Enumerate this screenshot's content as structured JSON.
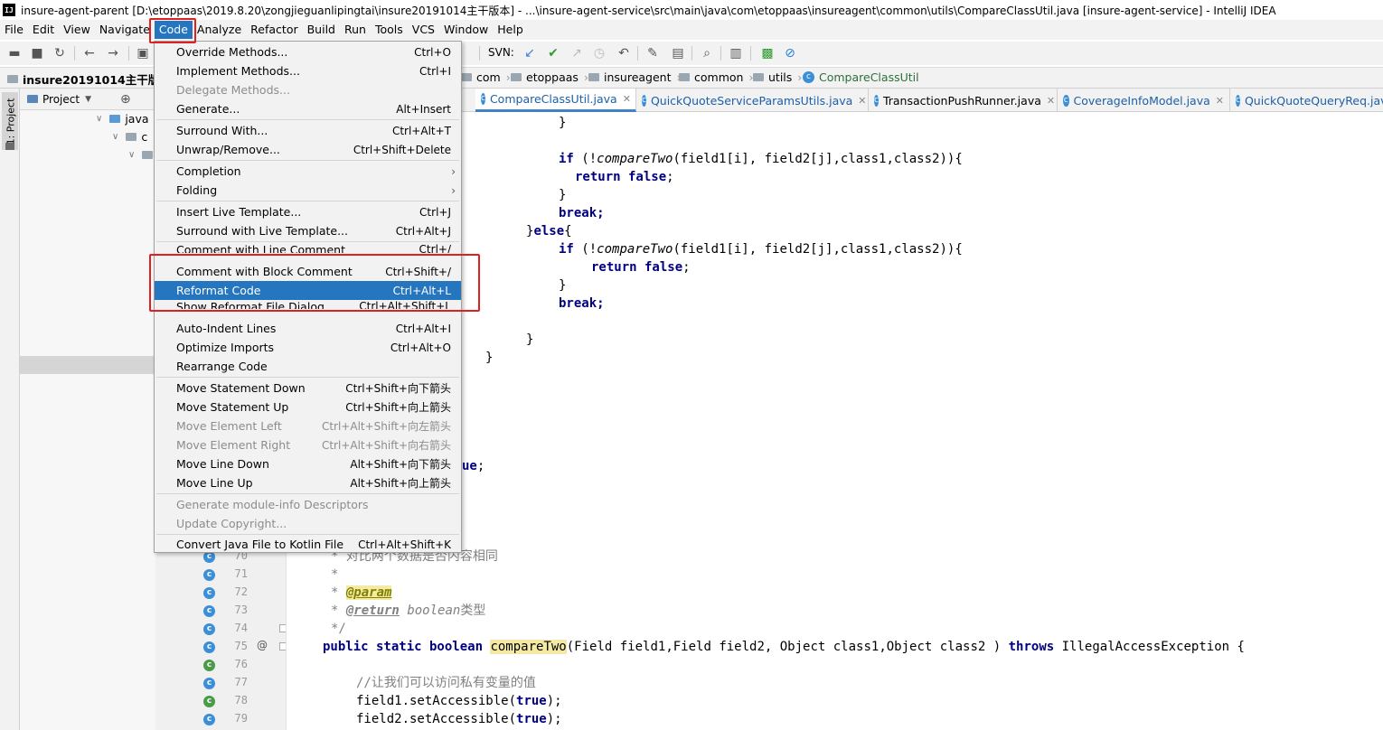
{
  "window": {
    "title": "insure-agent-parent [D:\\etoppaas\\2019.8.20\\zongjieguanlipingtai\\insure20191014主干版本] - ...\\insure-agent-service\\src\\main\\java\\com\\etoppaas\\insureagent\\common\\utils\\CompareClassUtil.java [insure-agent-service] - IntelliJ IDEA",
    "app_icon": "IJ"
  },
  "menubar": [
    "File",
    "Edit",
    "View",
    "Navigate",
    "Code",
    "Analyze",
    "Refactor",
    "Build",
    "Run",
    "Tools",
    "VCS",
    "Window",
    "Help"
  ],
  "toolbar": {
    "svn_label": "SVN:"
  },
  "navbar": {
    "project": "insure20191014主干版本",
    "crumbs": [
      "com",
      "etoppaas",
      "insureagent",
      "common",
      "utils",
      "CompareClassUtil"
    ]
  },
  "project_panel": {
    "stripe_label": "1: Project",
    "title": "Project",
    "tree": [
      {
        "label": "java"
      },
      {
        "label": "c"
      },
      {
        "label": ""
      }
    ]
  },
  "tabs": [
    "CompareClassUtil.java",
    "QuickQuoteServiceParamsUtils.java",
    "TransactionPushRunner.java",
    "CoverageInfoModel.java",
    "QuickQuoteQueryReq.java"
  ],
  "code_menu": {
    "items": [
      {
        "label": "Override Methods...",
        "shortcut": "Ctrl+O",
        "state": "enabled"
      },
      {
        "label": "Implement Methods...",
        "shortcut": "Ctrl+I",
        "state": "enabled"
      },
      {
        "label": "Delegate Methods...",
        "shortcut": "",
        "state": "disabled"
      },
      {
        "label": "Generate...",
        "shortcut": "Alt+Insert",
        "state": "enabled"
      },
      {
        "label": "Surround With...",
        "shortcut": "Ctrl+Alt+T",
        "state": "enabled"
      },
      {
        "label": "Unwrap/Remove...",
        "shortcut": "Ctrl+Shift+Delete",
        "state": "enabled"
      },
      {
        "label": "Completion",
        "shortcut": "",
        "state": "submenu"
      },
      {
        "label": "Folding",
        "shortcut": "",
        "state": "submenu"
      },
      {
        "label": "Insert Live Template...",
        "shortcut": "Ctrl+J",
        "state": "enabled"
      },
      {
        "label": "Surround with Live Template...",
        "shortcut": "Ctrl+Alt+J",
        "state": "enabled"
      },
      {
        "label": "Comment with Line Comment",
        "shortcut": "Ctrl+/",
        "state": "enabled"
      },
      {
        "label": "Comment with Block Comment",
        "shortcut": "Ctrl+Shift+/",
        "state": "enabled"
      },
      {
        "label": "Reformat Code",
        "shortcut": "Ctrl+Alt+L",
        "state": "selected"
      },
      {
        "label": "Show Reformat File Dialog",
        "shortcut": "Ctrl+Alt+Shift+L",
        "state": "enabled"
      },
      {
        "label": "Auto-Indent Lines",
        "shortcut": "Ctrl+Alt+I",
        "state": "enabled"
      },
      {
        "label": "Optimize Imports",
        "shortcut": "Ctrl+Alt+O",
        "state": "enabled"
      },
      {
        "label": "Rearrange Code",
        "shortcut": "",
        "state": "enabled"
      },
      {
        "label": "Move Statement Down",
        "shortcut": "Ctrl+Shift+向下箭头",
        "state": "enabled"
      },
      {
        "label": "Move Statement Up",
        "shortcut": "Ctrl+Shift+向上箭头",
        "state": "enabled"
      },
      {
        "label": "Move Element Left",
        "shortcut": "Ctrl+Alt+Shift+向左箭头",
        "state": "disabled"
      },
      {
        "label": "Move Element Right",
        "shortcut": "Ctrl+Alt+Shift+向右箭头",
        "state": "disabled"
      },
      {
        "label": "Move Line Down",
        "shortcut": "Alt+Shift+向下箭头",
        "state": "enabled"
      },
      {
        "label": "Move Line Up",
        "shortcut": "Alt+Shift+向上箭头",
        "state": "enabled"
      },
      {
        "label": "Generate module-info Descriptors",
        "shortcut": "",
        "state": "disabled"
      },
      {
        "label": "Update Copyright...",
        "shortcut": "",
        "state": "disabled"
      },
      {
        "label": "Convert Java File to Kotlin File",
        "shortcut": "Ctrl+Alt+Shift+K",
        "state": "enabled"
      }
    ]
  },
  "gutter": {
    "line_numbers": [
      "70",
      "71",
      "72",
      "73",
      "74",
      "75",
      "76",
      "77",
      "78",
      "79"
    ],
    "override_marker": "@"
  },
  "code": {
    "lines": [
      "}",
      "",
      "if (!compareTwo(field1[i], field2[j],class1,class2)){",
      "return false;",
      "}",
      "break;",
      "}else{",
      "if (!compareTwo(field1[i], field2[j],class1,class2)){",
      "return false;",
      "}",
      "break;",
      "",
      "}",
      "}",
      "ue;",
      "* 对比两个数据是否内容相同",
      "*",
      "* @param",
      "* @return boolean类型",
      "*/",
      "public static boolean compareTwo(Field field1,Field field2, Object class1,Object class2 ) throws IllegalAccessException {",
      "//让我们可以访问私有变量的值",
      "field1.setAccessible(true);",
      "field2.setAccessible(true);"
    ]
  }
}
